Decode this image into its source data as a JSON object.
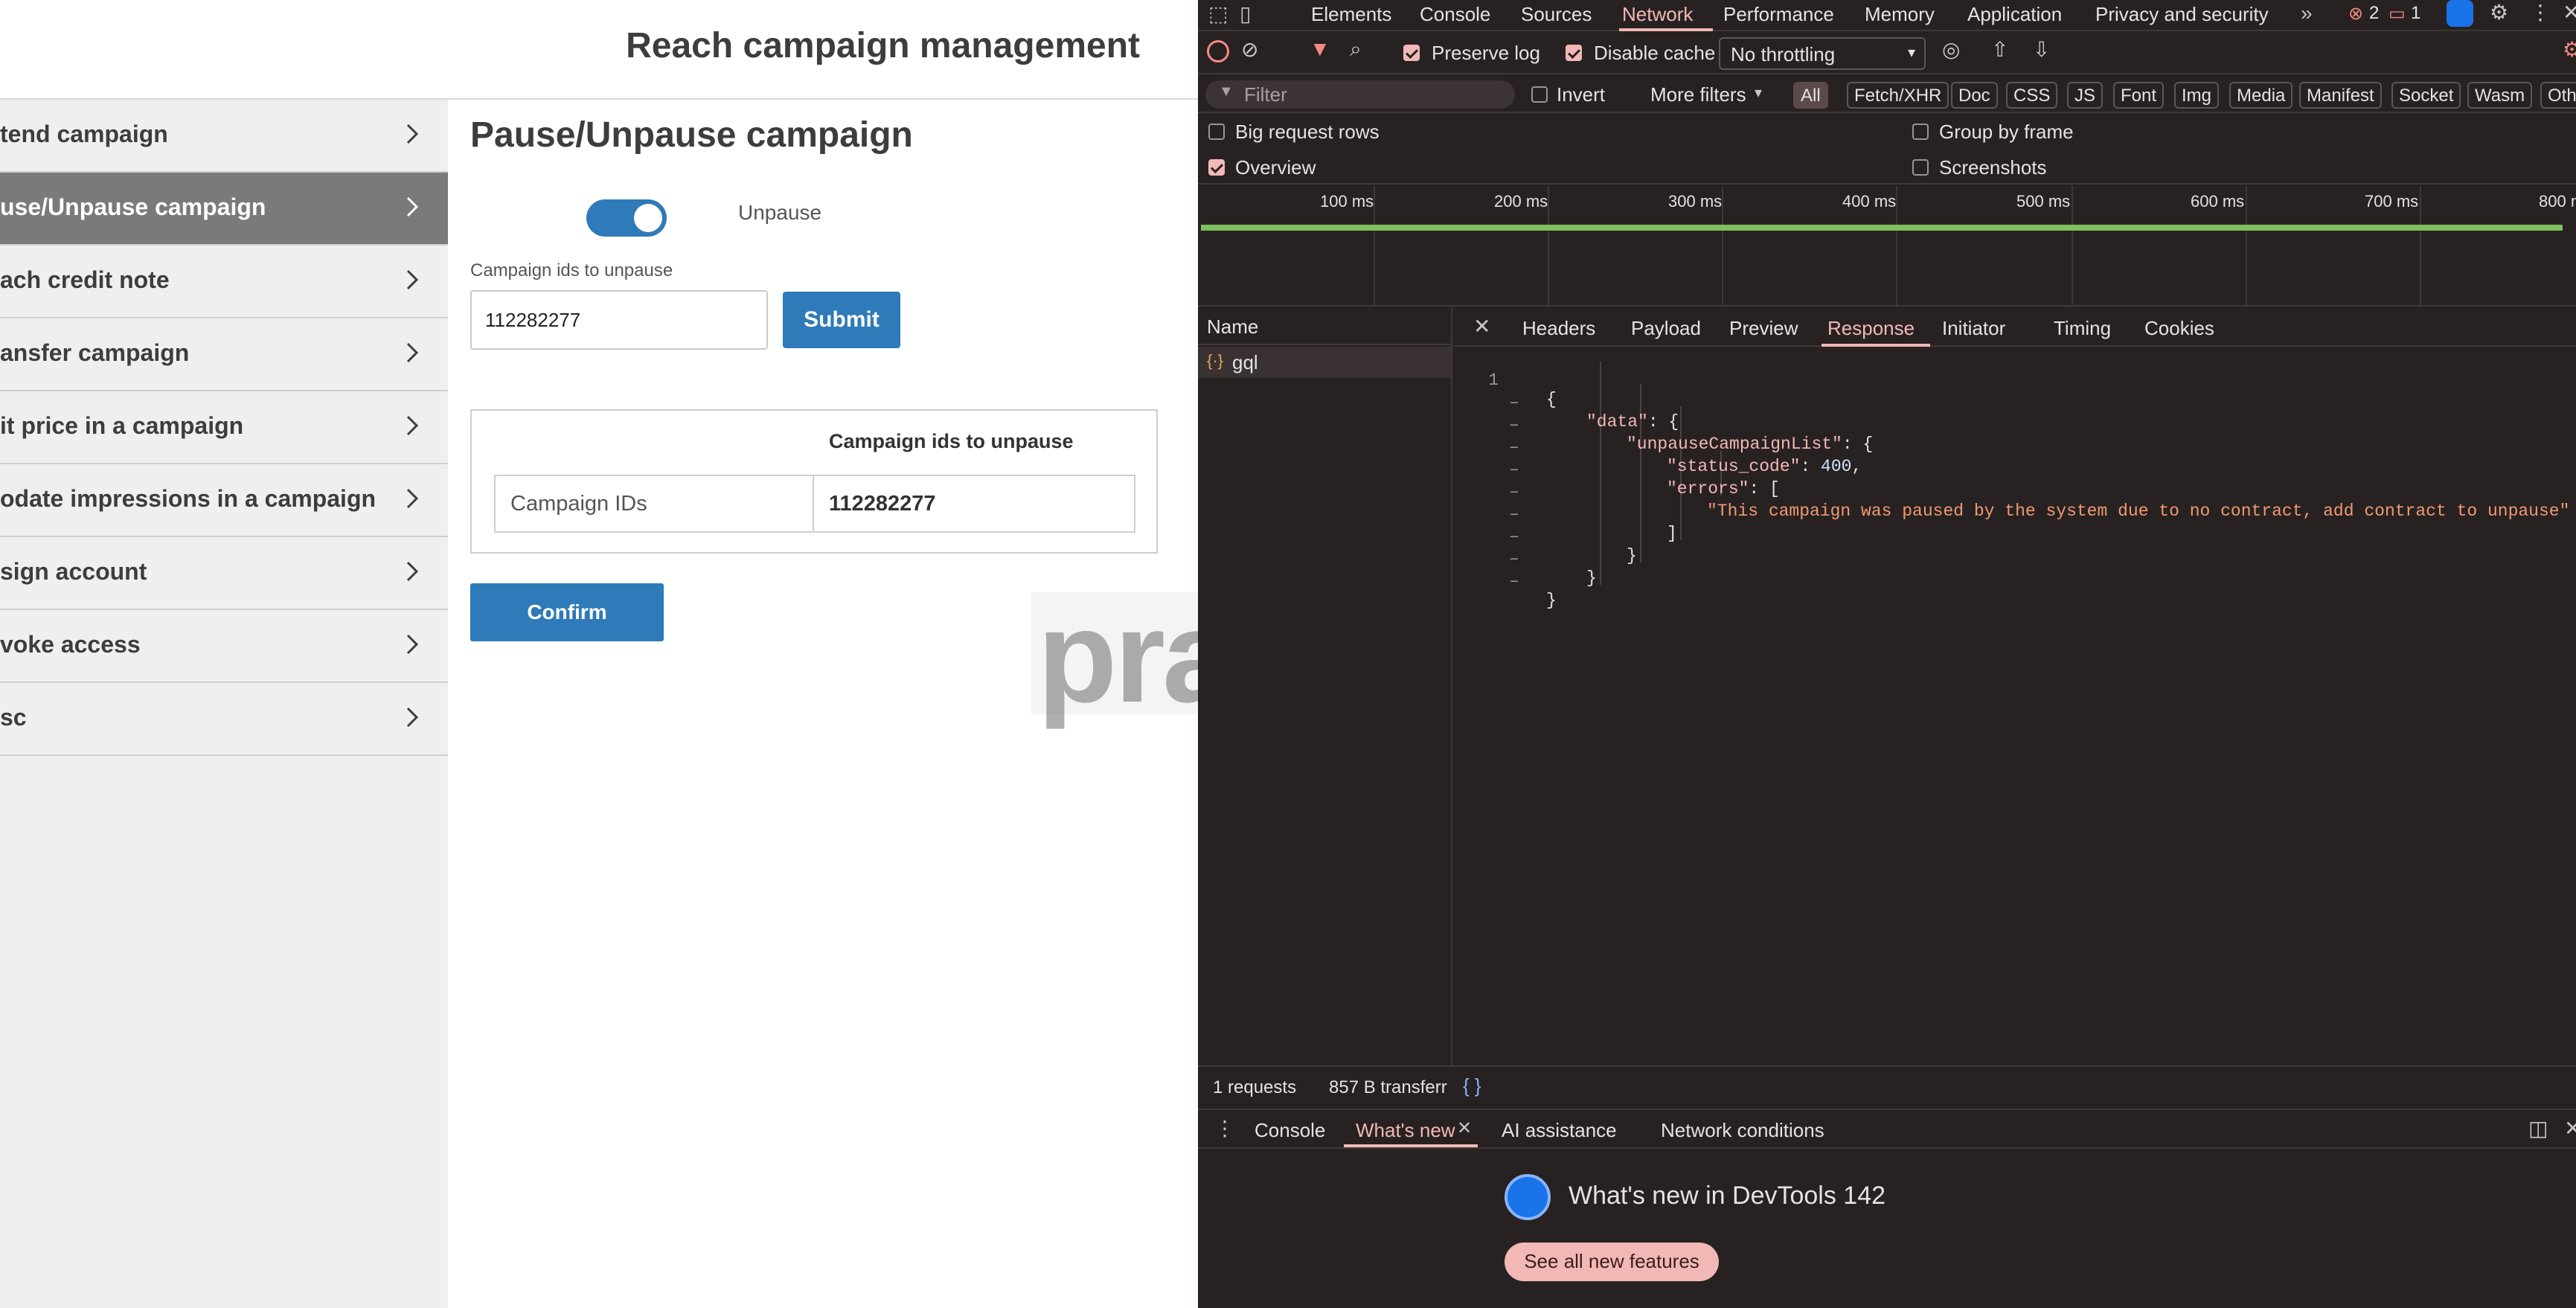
{
  "app": {
    "title": "Reach campaign management",
    "sidebar": [
      {
        "label": "tend campaign",
        "active": false
      },
      {
        "label": "use/Unpause campaign",
        "active": true
      },
      {
        "label": "ach credit note",
        "active": false
      },
      {
        "label": "ansfer campaign",
        "active": false
      },
      {
        "label": "it price in a campaign",
        "active": false
      },
      {
        "label": "odate impressions in a campaign",
        "active": false
      },
      {
        "label": "sign account",
        "active": false
      },
      {
        "label": "voke access",
        "active": false
      },
      {
        "label": "sc",
        "active": false
      }
    ],
    "section_title": "Pause/Unpause campaign",
    "toggle_label": "Unpause",
    "toggle_on": true,
    "ids_label": "Campaign ids to unpause",
    "ids_value": "112282277",
    "submit_label": "Submit",
    "summary_header": "Campaign ids to unpause",
    "summary_key": "Campaign IDs",
    "summary_value": "112282277",
    "confirm_label": "Confirm",
    "watermark": "practo"
  },
  "devtools": {
    "tabs": [
      "Elements",
      "Console",
      "Sources",
      "Network",
      "Performance",
      "Memory",
      "Application",
      "Privacy and security"
    ],
    "active_tab": "Network",
    "error_count": "2",
    "message_count": "1",
    "toolbar": {
      "preserve_log": "Preserve log",
      "disable_cache": "Disable cache",
      "throttling": "No throttling"
    },
    "filter": {
      "placeholder": "Filter",
      "invert": "Invert",
      "more_filters": "More filters",
      "types": [
        "All",
        "Fetch/XHR",
        "Doc",
        "CSS",
        "JS",
        "Font",
        "Img",
        "Media",
        "Manifest",
        "Socket",
        "Wasm",
        "Oth"
      ]
    },
    "options": {
      "big_rows": "Big request rows",
      "overview": "Overview",
      "group_by_frame": "Group by frame",
      "screenshots": "Screenshots"
    },
    "timeline_ticks": [
      "100 ms",
      "200 ms",
      "300 ms",
      "400 ms",
      "500 ms",
      "600 ms",
      "700 ms",
      "800 m"
    ],
    "name_header": "Name",
    "request_name": "gql",
    "detail_tabs": [
      "Headers",
      "Payload",
      "Preview",
      "Response",
      "Initiator",
      "Timing",
      "Cookies"
    ],
    "active_detail_tab": "Response",
    "response": {
      "data_key": "\"data\"",
      "list_key": "\"unpauseCampaignList\"",
      "status_key": "\"status_code\"",
      "status_value": "400",
      "errors_key": "\"errors\"",
      "error_message": "\"This campaign was paused by the system due to no contract, add contract to unpause\""
    },
    "status": {
      "requests": "1 requests",
      "transferred": "857 B transferr"
    },
    "drawer_tabs": [
      "Console",
      "What's new",
      "AI assistance",
      "Network conditions"
    ],
    "whats_new_title": "What's new in DevTools 142",
    "whats_new_button": "See all new features"
  },
  "colors": {
    "accent": "#2f7ab8",
    "sidebar_active": "#7a7a7a",
    "devtools_bg": "#282122",
    "devtools_accent": "#f2b8b5"
  }
}
